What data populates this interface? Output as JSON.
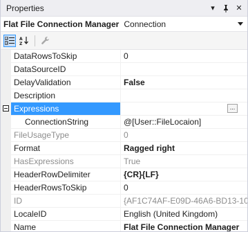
{
  "titlebar": {
    "title": "Properties",
    "dropdown_glyph": "▾",
    "pin_glyph": "📌",
    "close_glyph": "✕"
  },
  "object_selector": {
    "name": "Flat File Connection Manager",
    "type": "Connection",
    "dropdown_glyph": "▾"
  },
  "toolbar": {
    "buttons": [
      {
        "icon": "categorized-icon",
        "active": true
      },
      {
        "icon": "alphabetical-icon",
        "active": false
      },
      {
        "icon": "property-pages-icon",
        "active": false
      }
    ]
  },
  "properties": [
    {
      "name": "DataRowsToSkip",
      "value": "0",
      "style": "normal"
    },
    {
      "name": "DataSourceID",
      "value": "",
      "style": "normal"
    },
    {
      "name": "DelayValidation",
      "value": "False",
      "style": "bold"
    },
    {
      "name": "Description",
      "value": "",
      "style": "normal"
    },
    {
      "name": "Expressions",
      "value": "",
      "style": "normal",
      "selected": true,
      "expandable": true,
      "has_button": true
    },
    {
      "name": "ConnectionString",
      "value": "@[User::FileLocaion]",
      "style": "normal",
      "child": true
    },
    {
      "name": "FileUsageType",
      "value": "0",
      "style": "gray"
    },
    {
      "name": "Format",
      "value": "Ragged right",
      "style": "bold"
    },
    {
      "name": "HasExpressions",
      "value": "True",
      "style": "gray"
    },
    {
      "name": "HeaderRowDelimiter",
      "value": "{CR}{LF}",
      "style": "bold"
    },
    {
      "name": "HeaderRowsToSkip",
      "value": "0",
      "style": "normal"
    },
    {
      "name": "ID",
      "value": "{AF1C74AF-E09D-46A6-BD13-10",
      "style": "gray"
    },
    {
      "name": "LocaleID",
      "value": "English (United Kingdom)",
      "style": "normal"
    },
    {
      "name": "Name",
      "value": "Flat File Connection Manager",
      "style": "bold"
    }
  ],
  "ellipsis_label": "..."
}
